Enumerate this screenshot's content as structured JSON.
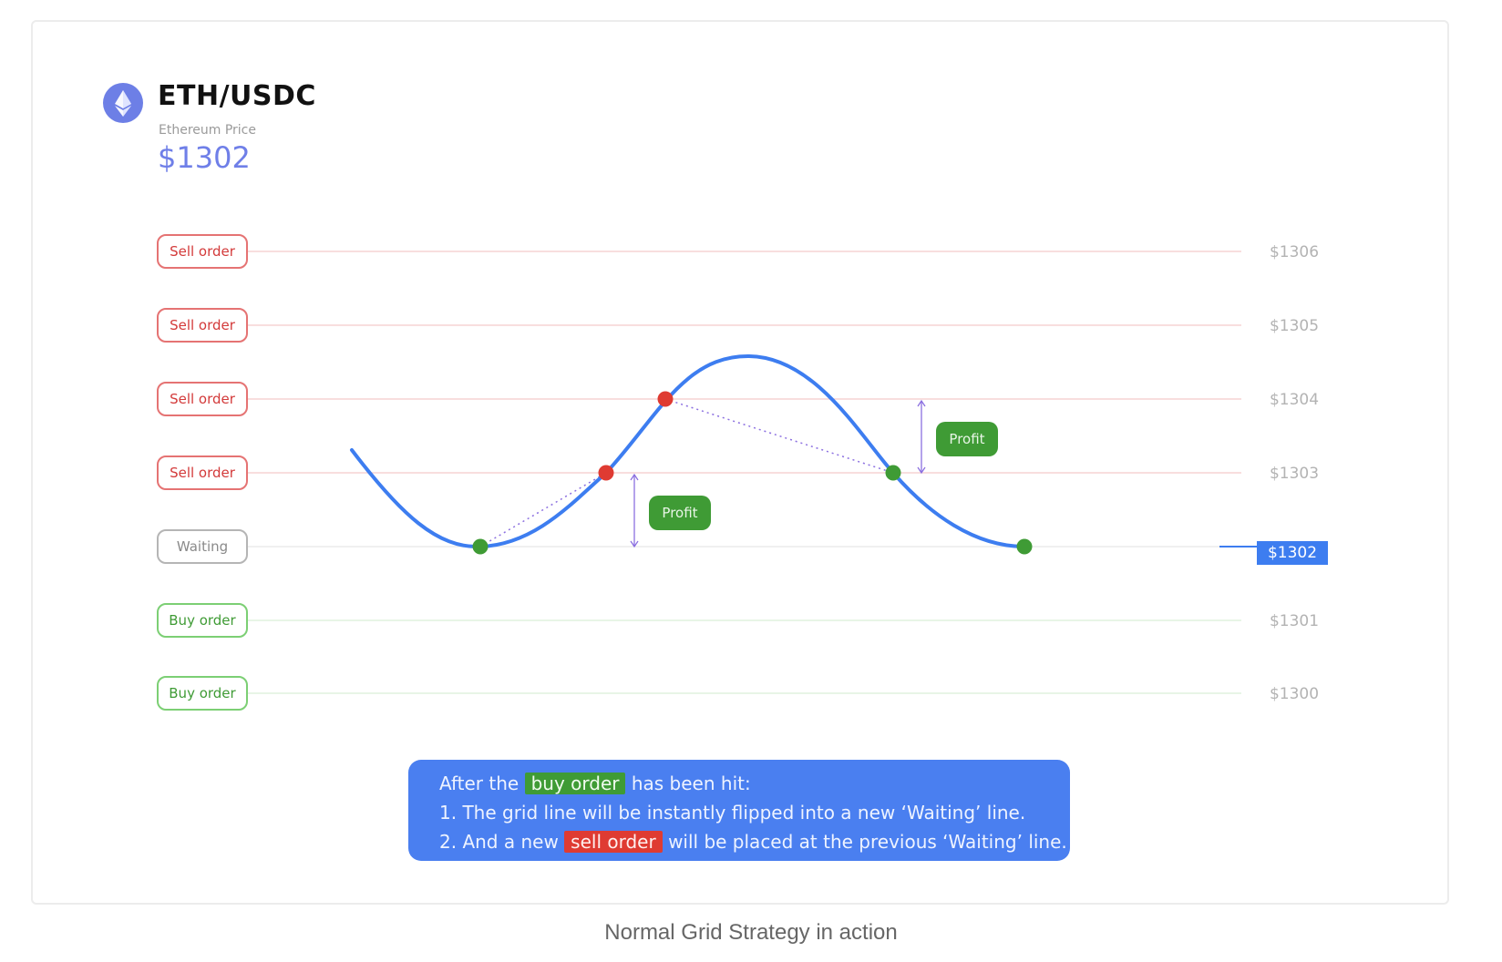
{
  "header": {
    "pair": "ETH/USDC",
    "price_label": "Ethereum Price",
    "price_value": "$1302",
    "logo_icon": "ethereum-icon",
    "logo_color": "#6d7fe6"
  },
  "grid": {
    "levels": [
      {
        "price": "$1306",
        "order": "Sell order",
        "kind": "sell"
      },
      {
        "price": "$1305",
        "order": "Sell order",
        "kind": "sell"
      },
      {
        "price": "$1304",
        "order": "Sell order",
        "kind": "sell"
      },
      {
        "price": "$1303",
        "order": "Sell order",
        "kind": "sell"
      },
      {
        "price": "$1302",
        "order": "Waiting",
        "kind": "wait"
      },
      {
        "price": "$1301",
        "order": "Buy order",
        "kind": "buy"
      },
      {
        "price": "$1300",
        "order": "Buy order",
        "kind": "buy"
      }
    ],
    "current_price": "$1302",
    "colors": {
      "sell": "#e57373",
      "buy": "#7ccf74",
      "wait": "#b5b5b5",
      "price_line": "#3d7df0"
    }
  },
  "annotations": {
    "profit_1": "Profit",
    "profit_2": "Profit"
  },
  "note": {
    "line1_prefix": "After the",
    "line1_highlight": "buy order",
    "line1_suffix": "has been hit:",
    "line2": "1. The grid line will be instantly flipped into a new ‘Waiting’ line.",
    "line3_prefix": "2. And a new",
    "line3_highlight": "sell order",
    "line3_suffix": "will be placed at the previous ‘Waiting’ line."
  },
  "caption": "Normal Grid Strategy in action"
}
